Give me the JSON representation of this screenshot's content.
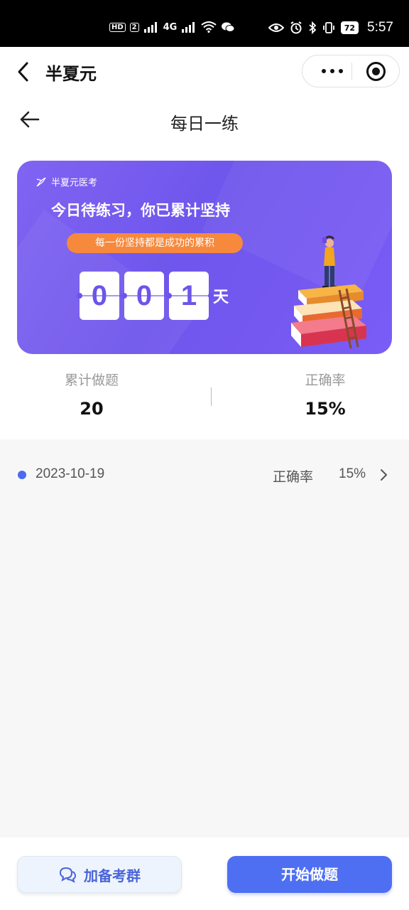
{
  "status_bar": {
    "left_labels": [
      "HD",
      "2",
      "4G"
    ],
    "battery": "72",
    "time": "5:57",
    "icons": [
      "hd-icon",
      "signal-icon",
      "wifi-icon",
      "wechat-icon",
      "eye-icon",
      "alarm-icon",
      "bluetooth-icon",
      "vibrate-icon",
      "battery-icon"
    ]
  },
  "app_bar": {
    "title": "半夏元",
    "icons": [
      "back-chevron-icon",
      "more-dots-icon",
      "target-icon"
    ]
  },
  "page_header": {
    "title": "每日一练",
    "icons": [
      "back-arrow-icon"
    ]
  },
  "banner": {
    "brand": "半夏元医考",
    "headline": "今日待练习，你已累计坚持",
    "motto": "每一份坚持都是成功的累积",
    "digits": [
      "0",
      "0",
      "1"
    ],
    "unit": "天",
    "colors": {
      "gradient_start": "#8064f2",
      "gradient_end": "#7a5cf6",
      "motto_bg": "#f7893d"
    }
  },
  "stats": {
    "total_label": "累计做题",
    "total_value": "20",
    "accuracy_label": "正确率",
    "accuracy_value": "15%"
  },
  "records": [
    {
      "date": "2023-10-19",
      "rate_label": "正确率",
      "rate_value": "15%"
    }
  ],
  "bottom": {
    "group_label": "加备考群",
    "start_label": "开始做题",
    "colors": {
      "primary": "#4f6ff2",
      "secondary_bg": "#eef4fd"
    }
  }
}
